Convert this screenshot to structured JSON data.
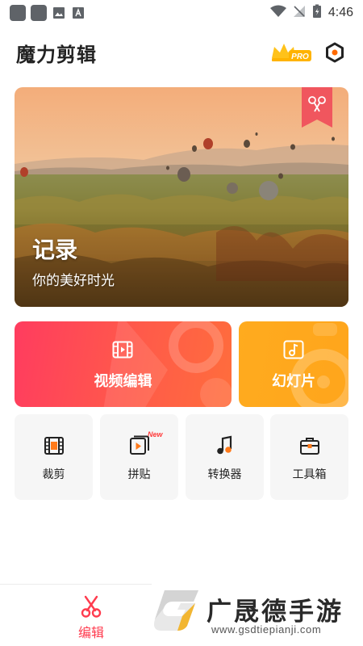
{
  "status_bar": {
    "time": "4:46"
  },
  "header": {
    "title": "魔力剪辑",
    "pro_badge": "PRO"
  },
  "banner": {
    "title": "记录",
    "subtitle": "你的美好时光"
  },
  "cards": {
    "video_edit": "视频编辑",
    "slideshow": "幻灯片"
  },
  "tools": [
    {
      "label": "裁剪",
      "icon": "crop-film-icon"
    },
    {
      "label": "拼贴",
      "icon": "collage-icon",
      "badge": "New"
    },
    {
      "label": "转换器",
      "icon": "music-note-icon"
    },
    {
      "label": "工具箱",
      "icon": "toolbox-icon"
    }
  ],
  "bottom_nav": {
    "edit_label": "编辑"
  },
  "watermark": {
    "text": "广晟德手游",
    "url": "www.gsdtiepianji.com"
  },
  "colors": {
    "accent": "#ff3b4e",
    "video_card": "#ff4a55",
    "slide_card": "#ffa81e"
  }
}
